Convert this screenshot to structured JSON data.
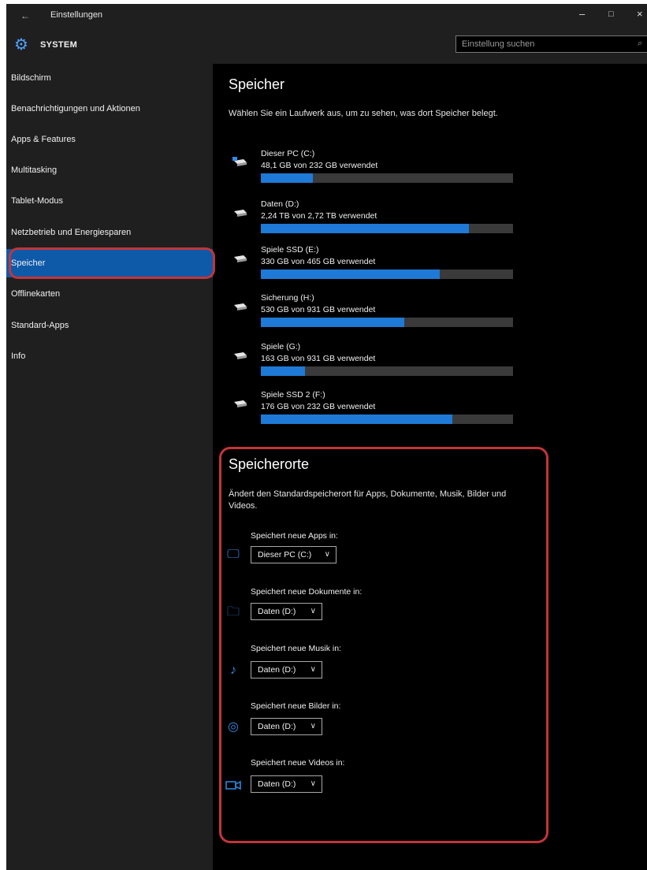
{
  "window": {
    "title": "Einstellungen",
    "back_icon": "back-arrow-icon",
    "controls": {
      "minimize": "–",
      "maximize": "□",
      "close": "×"
    }
  },
  "header": {
    "section": "SYSTEM",
    "search_placeholder": "Einstellung suchen"
  },
  "sidebar": {
    "items": [
      {
        "label": "Bildschirm",
        "active": false
      },
      {
        "label": "Benachrichtigungen und Aktionen",
        "active": false
      },
      {
        "label": "Apps & Features",
        "active": false
      },
      {
        "label": "Multitasking",
        "active": false
      },
      {
        "label": "Tablet-Modus",
        "active": false
      },
      {
        "label": "Netzbetrieb und Energiesparen",
        "active": false
      },
      {
        "label": "Speicher",
        "active": true
      },
      {
        "label": "Offlinekarten",
        "active": false
      },
      {
        "label": "Standard-Apps",
        "active": false
      },
      {
        "label": "Info",
        "active": false
      }
    ]
  },
  "storage": {
    "title": "Speicher",
    "description": "Wählen Sie ein Laufwerk aus, um zu sehen, was dort Speicher belegt.",
    "drives": [
      {
        "name": "Dieser PC (C:)",
        "usage": "48,1 GB von 232 GB verwendet",
        "fraction": 0.207,
        "icon": "windows-drive-icon"
      },
      {
        "name": "Daten (D:)",
        "usage": "2,24 TB von 2,72 TB verwendet",
        "fraction": 0.824,
        "icon": "drive-icon"
      },
      {
        "name": "Spiele SSD (E:)",
        "usage": "330 GB von 465 GB verwendet",
        "fraction": 0.71,
        "icon": "drive-icon"
      },
      {
        "name": "Sicherung (H:)",
        "usage": "530 GB von 931 GB verwendet",
        "fraction": 0.569,
        "icon": "drive-icon"
      },
      {
        "name": "Spiele (G:)",
        "usage": "163 GB von 931 GB verwendet",
        "fraction": 0.175,
        "icon": "drive-icon"
      },
      {
        "name": "Spiele SSD 2 (F:)",
        "usage": "176 GB von 232 GB verwendet",
        "fraction": 0.759,
        "icon": "drive-icon"
      }
    ]
  },
  "locations": {
    "title": "Speicherorte",
    "description": "Ändert den Standardspeicherort für Apps, Dokumente, Musik, Bilder und Videos.",
    "items": [
      {
        "label": "Speichert neue Apps in:",
        "value": "Dieser PC (C:)",
        "icon": "monitor-icon"
      },
      {
        "label": "Speichert neue Dokumente in:",
        "value": "Daten (D:)",
        "icon": "folder-icon"
      },
      {
        "label": "Speichert neue Musik in:",
        "value": "Daten (D:)",
        "icon": "music-note-icon"
      },
      {
        "label": "Speichert neue Bilder in:",
        "value": "Daten (D:)",
        "icon": "camera-icon"
      },
      {
        "label": "Speichert neue Videos in:",
        "value": "Daten (D:)",
        "icon": "video-camera-icon"
      }
    ]
  },
  "colors": {
    "accent": "#1e7ad6",
    "highlight_outline": "#c1353a",
    "sidebar_bg": "#1f1f1f",
    "content_bg": "#000000"
  }
}
